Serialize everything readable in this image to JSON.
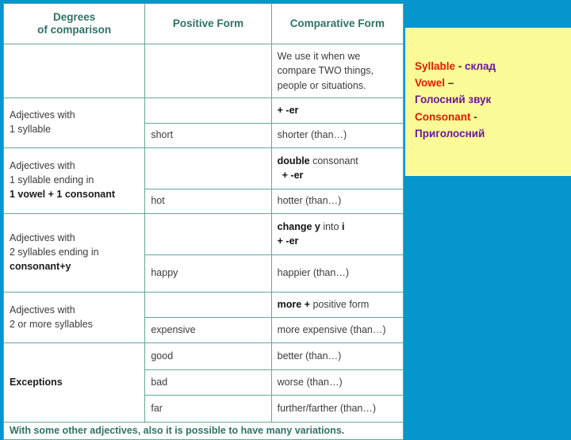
{
  "slide": {
    "background_color": "#0795ce"
  },
  "table": {
    "headers": {
      "col1_line1": "Degrees",
      "col1_line2": "of comparison",
      "col2": "Positive Form",
      "col3": "Comparative Form"
    },
    "intro": {
      "line1": "We use it when we",
      "line2": "compare TWO things,",
      "line3": "people or situations."
    },
    "rows": [
      {
        "category_lines": [
          "Adjectives with",
          "1 syllable"
        ],
        "category_bold_line": "",
        "rule_plain_prefix": "",
        "rule_bold": "+ -er",
        "rule_plain_suffix": "",
        "rule_line2_bold": "",
        "rule_line2_plain": "",
        "positive": "short",
        "comparative": "shorter (than…)"
      },
      {
        "category_lines": [
          "Adjectives with",
          "1 syllable ending in"
        ],
        "category_bold_line": "1 vowel + 1 consonant",
        "rule_plain_prefix": "",
        "rule_bold": "double",
        "rule_plain_suffix": " consonant",
        "rule_line2_bold": "+ -er",
        "rule_line2_plain": "",
        "positive": "hot",
        "comparative": "hotter (than…)"
      },
      {
        "category_lines": [
          "Adjectives with",
          "2 syllables ending in"
        ],
        "category_bold_line": "consonant+y",
        "rule_plain_prefix": "",
        "rule_bold": "change y",
        "rule_plain_suffix": " into ",
        "rule_bold2": "i",
        "rule_line2_bold": "+  -er",
        "rule_line2_plain": "",
        "positive": "happy",
        "comparative": "happier (than…)"
      },
      {
        "category_lines": [
          "Adjectives with",
          "2 or more syllables"
        ],
        "category_bold_line": "",
        "rule_plain_prefix": "",
        "rule_bold": "more +",
        "rule_plain_suffix": " positive form",
        "rule_line2_bold": "",
        "rule_line2_plain": "",
        "positive": "expensive",
        "comparative": "more expensive (than…)"
      }
    ],
    "exceptions": {
      "label": "Exceptions",
      "items": [
        {
          "positive": "good",
          "comparative": "better (than…)"
        },
        {
          "positive": "bad",
          "comparative": "worse (than…)"
        },
        {
          "positive": "far",
          "comparative": "further/farther (than…)"
        }
      ]
    },
    "footer_partial": "With some other adjectives, also it is possible to have many variations."
  },
  "note": {
    "background_color": "#fafa96",
    "english_color": "#e01b00",
    "ukrainian_color": "#6b189b",
    "lines": [
      {
        "en": "Syllable",
        "sep": " -  ",
        "ua": "склад"
      },
      {
        "en": "Vowel",
        "sep": " – ",
        "ua": ""
      },
      {
        "en": "",
        "sep": "",
        "ua": "Голосний звук"
      },
      {
        "en": "Consonant",
        "sep": " - ",
        "ua": ""
      },
      {
        "en": "",
        "sep": "",
        "ua": "Приголосний"
      }
    ]
  }
}
